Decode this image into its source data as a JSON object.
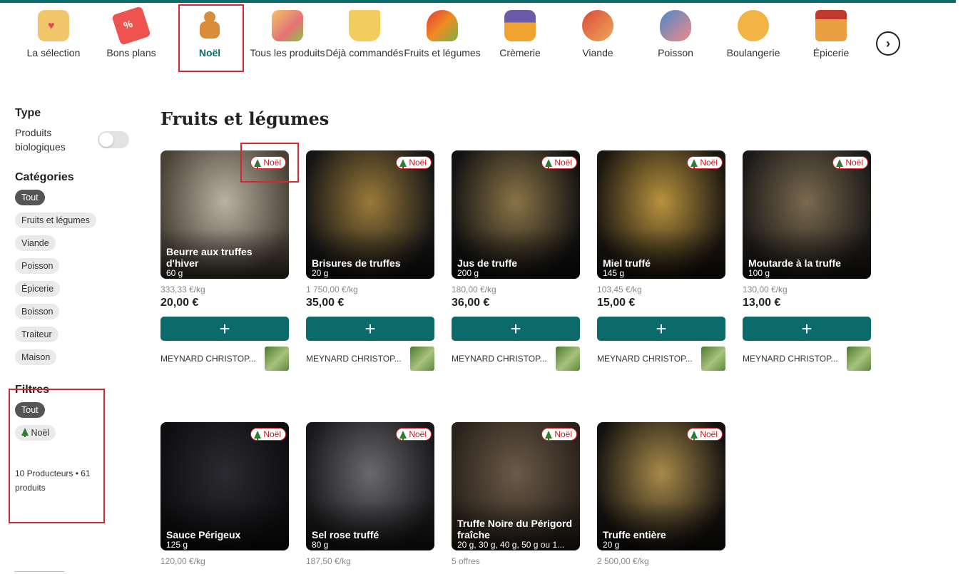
{
  "categories": [
    {
      "label": "La sélection",
      "icon": "bag-heart-icon"
    },
    {
      "label": "Bons plans",
      "icon": "discount-tag-icon"
    },
    {
      "label": "Noël",
      "icon": "gingerbread-icon",
      "active": true
    },
    {
      "label": "Tous les produits",
      "icon": "mixed-products-icon"
    },
    {
      "label": "Déjà commandés",
      "icon": "basket-icon"
    },
    {
      "label": "Fruits et légumes",
      "icon": "vegetables-icon"
    },
    {
      "label": "Crèmerie",
      "icon": "cheese-eggs-icon"
    },
    {
      "label": "Viande",
      "icon": "meat-icon"
    },
    {
      "label": "Poisson",
      "icon": "fish-icon"
    },
    {
      "label": "Boulangerie",
      "icon": "bread-icon"
    },
    {
      "label": "Épicerie",
      "icon": "jar-icon"
    }
  ],
  "nav_next_icon": "chevron-right-icon",
  "sidebar": {
    "type_title": "Type",
    "bio_label": "Produits biologiques",
    "bio_enabled": false,
    "categories_title": "Catégories",
    "category_chips": [
      "Tout",
      "Fruits et légumes",
      "Viande",
      "Poisson",
      "Épicerie",
      "Boisson",
      "Traiteur",
      "Maison"
    ],
    "filters_title": "Filtres",
    "filter_all": "Tout",
    "filter_noel": "Noël",
    "counts": "10 Producteurs • 61 produits"
  },
  "main": {
    "title": "Fruits et légumes",
    "badge": "Noël",
    "products": [
      {
        "name": "Beurre aux truffes d'hiver",
        "weight": "60 g",
        "unit_price": "333,33 €/kg",
        "price": "20,00 €",
        "producer": "MEYNARD CHRISTOP...",
        "color1": "#b9b2a4",
        "color2": "#4a4236"
      },
      {
        "name": "Brisures de truffes",
        "weight": "20 g",
        "unit_price": "1 750,00 €/kg",
        "price": "35,00 €",
        "producer": "MEYNARD CHRISTOP...",
        "color1": "#9a7a3a",
        "color2": "#151515"
      },
      {
        "name": "Jus de truffe",
        "weight": "200 g",
        "unit_price": "180,00 €/kg",
        "price": "36,00 €",
        "producer": "MEYNARD CHRISTOP...",
        "color1": "#8a7446",
        "color2": "#121212"
      },
      {
        "name": "Miel truffé",
        "weight": "145 g",
        "unit_price": "103,45 €/kg",
        "price": "15,00 €",
        "producer": "MEYNARD CHRISTOP...",
        "color1": "#b8923e",
        "color2": "#1a1610"
      },
      {
        "name": "Moutarde à la truffe",
        "weight": "100 g",
        "unit_price": "130,00 €/kg",
        "price": "13,00 €",
        "producer": "MEYNARD CHRISTOP...",
        "color1": "#7a6a4e",
        "color2": "#1c1a18"
      },
      {
        "name": "Sauce Périgeux",
        "weight": "125 g",
        "unit_price": "120,00 €/kg",
        "price": "",
        "producer": "",
        "color1": "#2a2a30",
        "color2": "#0e0e10"
      },
      {
        "name": "Sel rose truffé",
        "weight": "80 g",
        "unit_price": "187,50 €/kg",
        "price": "",
        "producer": "",
        "color1": "#6a6a6e",
        "color2": "#18181a"
      },
      {
        "name": "Truffe Noire du Périgord fraîche",
        "weight": "20 g, 30 g, 40 g, 50 g ou 1...",
        "unit_price": "5 offres",
        "price": "",
        "producer": "",
        "color1": "#6a5a48",
        "color2": "#2a221a"
      },
      {
        "name": "Truffe entière",
        "weight": "20 g",
        "unit_price": "2 500,00 €/kg",
        "price": "",
        "producer": "",
        "color1": "#a88a4a",
        "color2": "#141210"
      }
    ]
  },
  "colors": {
    "accent": "#0b6b6b",
    "highlight": "#d9262c",
    "badge_text": "#c01c1c"
  }
}
